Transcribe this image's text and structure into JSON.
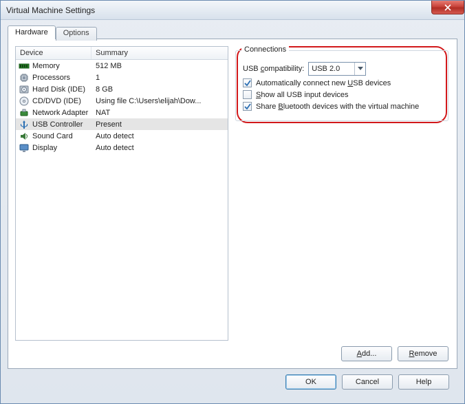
{
  "window": {
    "title": "Virtual Machine Settings"
  },
  "tabs": [
    {
      "label": "Hardware",
      "active": true
    },
    {
      "label": "Options",
      "active": false
    }
  ],
  "columns": {
    "device": "Device",
    "summary": "Summary"
  },
  "devices": [
    {
      "icon": "memory-icon",
      "name": "Memory",
      "summary": "512 MB",
      "selected": false
    },
    {
      "icon": "cpu-icon",
      "name": "Processors",
      "summary": "1",
      "selected": false
    },
    {
      "icon": "disk-icon",
      "name": "Hard Disk (IDE)",
      "summary": "8 GB",
      "selected": false
    },
    {
      "icon": "cd-icon",
      "name": "CD/DVD (IDE)",
      "summary": "Using file C:\\Users\\elijah\\Dow...",
      "selected": false
    },
    {
      "icon": "net-icon",
      "name": "Network Adapter",
      "summary": "NAT",
      "selected": false
    },
    {
      "icon": "usb-icon",
      "name": "USB Controller",
      "summary": "Present",
      "selected": true
    },
    {
      "icon": "sound-icon",
      "name": "Sound Card",
      "summary": "Auto detect",
      "selected": false
    },
    {
      "icon": "display-icon",
      "name": "Display",
      "summary": "Auto detect",
      "selected": false
    }
  ],
  "connections": {
    "title": "Connections",
    "compat_label_pre": "USB ",
    "compat_label_u": "c",
    "compat_label_post": "ompatibility:",
    "compat_value": "USB 2.0",
    "auto_pre": "Automatically connect new ",
    "auto_u": "U",
    "auto_post": "SB devices",
    "auto_checked": true,
    "showall_u": "S",
    "showall_post": "how all USB input devices",
    "showall_checked": false,
    "bt_pre": "Share ",
    "bt_u": "B",
    "bt_post": "luetooth devices with the virtual machine",
    "bt_checked": true
  },
  "panel_buttons": {
    "add_u": "A",
    "add_post": "dd...",
    "remove_u": "R",
    "remove_post": "emove"
  },
  "footer": {
    "ok": "OK",
    "cancel": "Cancel",
    "help": "Help"
  }
}
